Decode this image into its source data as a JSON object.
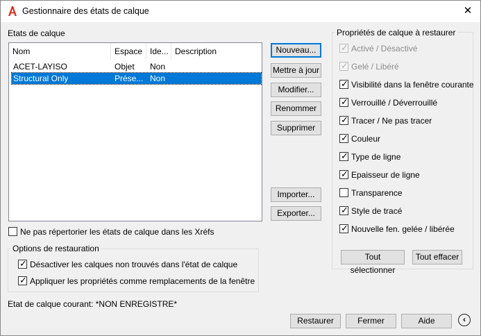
{
  "window": {
    "title": "Gestionnaire des états de calque",
    "app_icon": "autocad-a-icon",
    "close_glyph": "✕"
  },
  "states_section": {
    "label": "Etats de calque",
    "columns": [
      "Nom",
      "Espace",
      "Ide...",
      "Description"
    ],
    "rows": [
      {
        "name": "ACET-LAYISO",
        "space": "Objet",
        "ide": "Non",
        "description": ""
      },
      {
        "name": "Structural Only",
        "space": "Prése...",
        "ide": "Non",
        "description": ""
      }
    ],
    "selected_row": 1
  },
  "buttons": {
    "new": "Nouveau...",
    "update": "Mettre à jour",
    "edit": "Modifier...",
    "rename": "Renommer",
    "delete": "Supprimer",
    "import": "Importer...",
    "export": "Exporter...",
    "select_all": "Tout sélectionner",
    "clear_all": "Tout effacer",
    "restore": "Restaurer",
    "close": "Fermer",
    "help": "Aide"
  },
  "no_xref": {
    "label": "Ne pas répertorier les états de calque dans les Xréfs",
    "checked": false
  },
  "restore_options": {
    "title": "Options de restauration",
    "items": [
      {
        "label": "Désactiver les calques non trouvés dans l'état de calque",
        "checked": true
      },
      {
        "label": "Appliquer les propriétés comme remplacements de la fenêtre",
        "checked": true
      }
    ]
  },
  "current_state": "Etat de calque courant: *NON ENREGISTRE*",
  "properties": {
    "title": "Propriétés de calque à restaurer",
    "items": [
      {
        "label": "Activé / Désactivé",
        "checked": true,
        "disabled": true
      },
      {
        "label": "Gelé / Libéré",
        "checked": true,
        "disabled": true
      },
      {
        "label": "Visibilité dans la fenêtre courante",
        "checked": true,
        "disabled": false
      },
      {
        "label": "Verrouillé / Déverrouillé",
        "checked": true,
        "disabled": false
      },
      {
        "label": "Tracer / Ne pas tracer",
        "checked": true,
        "disabled": false
      },
      {
        "label": "Couleur",
        "checked": true,
        "disabled": false
      },
      {
        "label": "Type de ligne",
        "checked": true,
        "disabled": false
      },
      {
        "label": "Epaisseur de ligne",
        "checked": true,
        "disabled": false
      },
      {
        "label": "Transparence",
        "checked": false,
        "disabled": false
      },
      {
        "label": "Style de tracé",
        "checked": true,
        "disabled": false
      },
      {
        "label": "Nouvelle fen. gelée / libérée",
        "checked": true,
        "disabled": false
      }
    ]
  },
  "more_icon": "chevron-left-circle-icon",
  "colors": {
    "selection": "#0078d7",
    "accent_red": "#d52b1e"
  }
}
